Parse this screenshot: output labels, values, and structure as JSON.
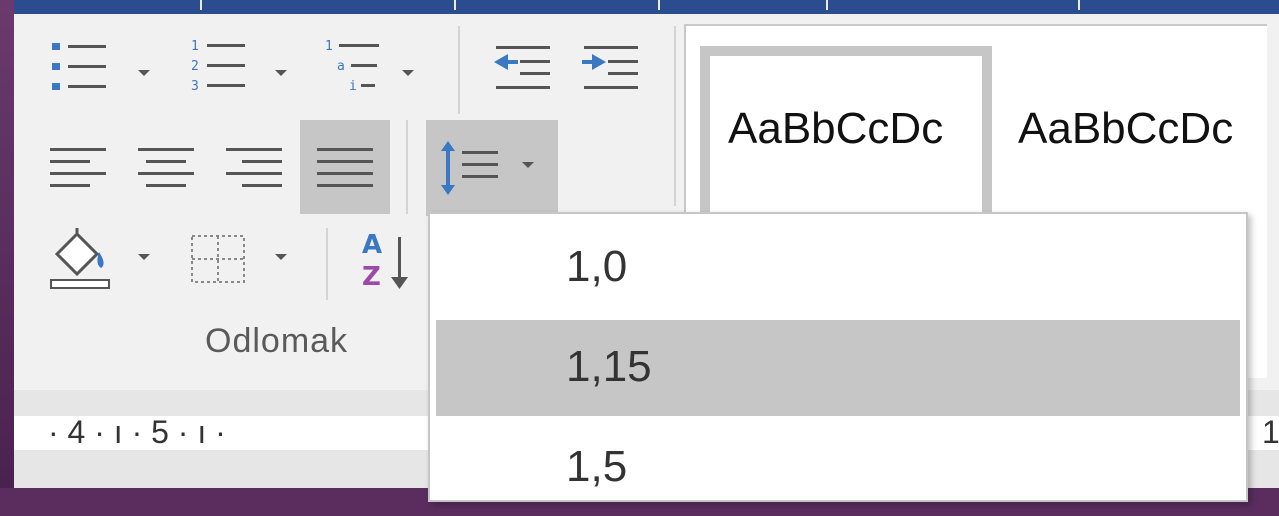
{
  "ribbon": {
    "paragraph_group_label": "Odlomak"
  },
  "styles_gallery": {
    "samples": [
      "AaBbCcDc",
      "AaBbCcDc"
    ]
  },
  "line_spacing_menu": {
    "options": [
      "1,0",
      "1,15",
      "1,5"
    ],
    "highlighted": "1,15"
  },
  "ruler": {
    "text": "· 4 · ı · 5 · ı ·",
    "right_text": "1"
  },
  "icons": [
    "bullets-icon",
    "numbering-icon",
    "multilevel-list-icon",
    "decrease-indent-icon",
    "increase-indent-icon",
    "align-left-icon",
    "center-icon",
    "align-right-icon",
    "justify-icon",
    "line-spacing-icon",
    "shading-icon",
    "borders-icon",
    "sort-icon"
  ],
  "colors": {
    "accent_blue": "#2b4d8f",
    "highlight_gray": "#c6c6c6",
    "icon_blue": "#3a78c4",
    "sort_purple": "#9b4aa8"
  }
}
